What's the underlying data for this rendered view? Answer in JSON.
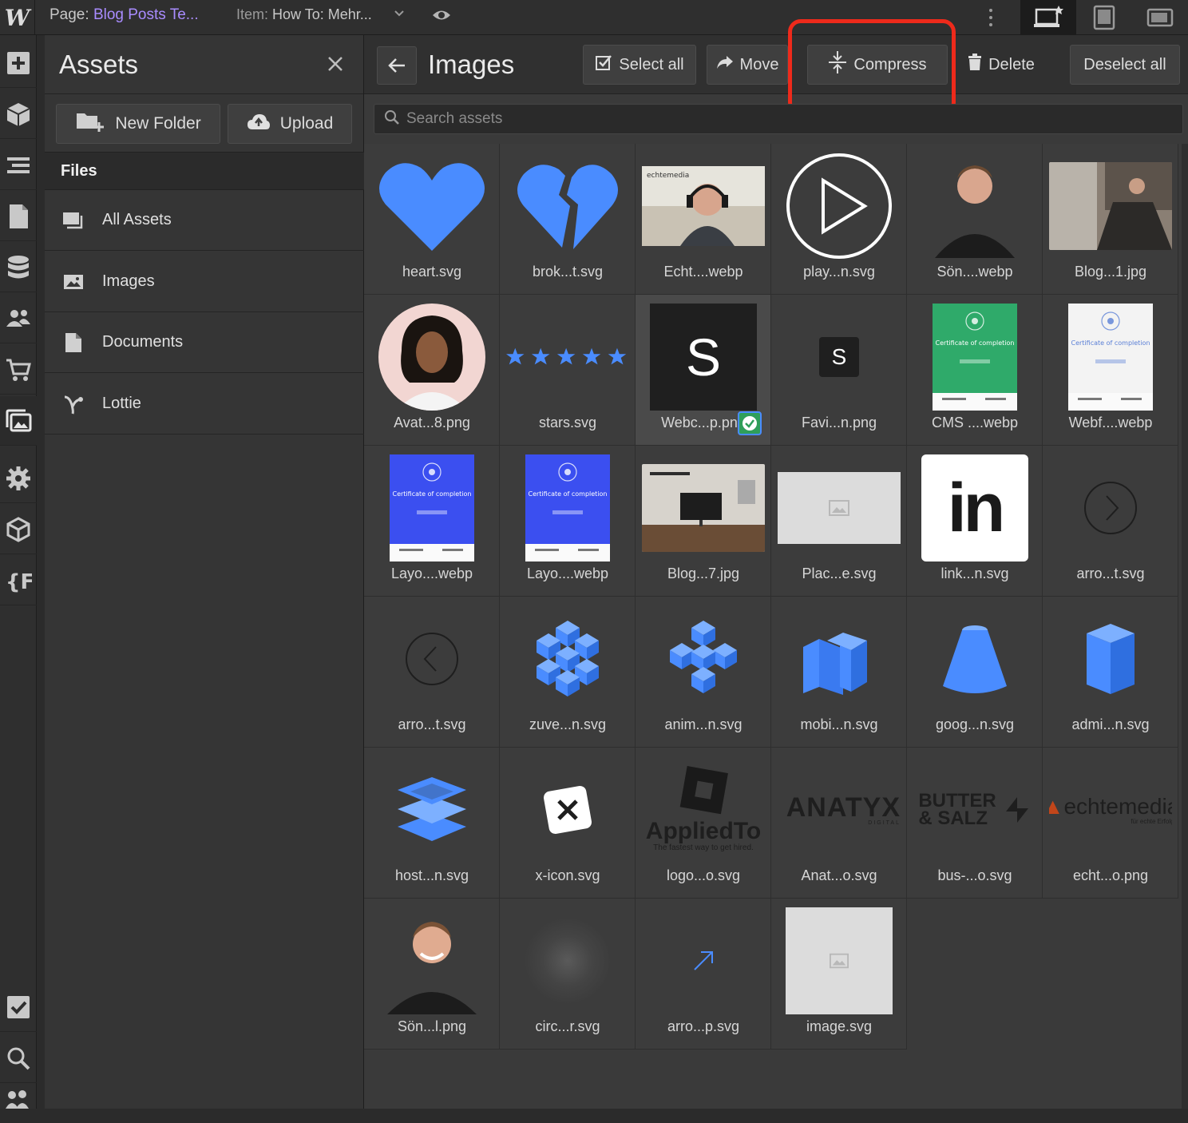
{
  "topbar": {
    "logo": "W",
    "page_prefix": "Page:",
    "page_name": "Blog Posts Te...",
    "item_prefix": "Item:",
    "item_name": "How To: Mehr..."
  },
  "assets_panel": {
    "title": "Assets",
    "new_folder_label": "New Folder",
    "upload_label": "Upload",
    "files_heading": "Files",
    "folders": [
      {
        "label": "All Assets",
        "icon": "all-assets-icon"
      },
      {
        "label": "Images",
        "icon": "image-icon"
      },
      {
        "label": "Documents",
        "icon": "document-icon"
      },
      {
        "label": "Lottie",
        "icon": "lottie-icon"
      }
    ]
  },
  "main": {
    "title": "Images",
    "toolbar": {
      "select_all": "Select all",
      "move": "Move",
      "compress": "Compress",
      "delete": "Delete",
      "deselect_all": "Deselect all"
    },
    "search_placeholder": "Search assets",
    "assets": [
      {
        "name": "heart.svg",
        "kind": "heart"
      },
      {
        "name": "brok...t.svg",
        "kind": "broken-heart"
      },
      {
        "name": "Echt....webp",
        "kind": "photo-webcam"
      },
      {
        "name": "play...n.svg",
        "kind": "play"
      },
      {
        "name": "Sön....webp",
        "kind": "photo-person"
      },
      {
        "name": "Blog...1.jpg",
        "kind": "photo-room"
      },
      {
        "name": "Avat...8.png",
        "kind": "avatar"
      },
      {
        "name": "stars.svg",
        "kind": "stars"
      },
      {
        "name": "Webc...p.png",
        "kind": "s-large",
        "selected": true
      },
      {
        "name": "Favi...n.png",
        "kind": "s-small"
      },
      {
        "name": "CMS ....webp",
        "kind": "cert-green"
      },
      {
        "name": "Webf....webp",
        "kind": "cert-white"
      },
      {
        "name": "Layo....webp",
        "kind": "cert-blue"
      },
      {
        "name": "Layo....webp",
        "kind": "cert-blue"
      },
      {
        "name": "Blog...7.jpg",
        "kind": "photo-desk"
      },
      {
        "name": "Plac...e.svg",
        "kind": "placeholder-wide"
      },
      {
        "name": "link...n.svg",
        "kind": "linkedin"
      },
      {
        "name": "arro...t.svg",
        "kind": "arrow-right-circle"
      },
      {
        "name": "arro...t.svg",
        "kind": "arrow-left-circle"
      },
      {
        "name": "zuve...n.svg",
        "kind": "cubes"
      },
      {
        "name": "anim...n.svg",
        "kind": "cross-cube"
      },
      {
        "name": "mobi...n.svg",
        "kind": "blocks"
      },
      {
        "name": "goog...n.svg",
        "kind": "cone"
      },
      {
        "name": "admi...n.svg",
        "kind": "prism"
      },
      {
        "name": "host...n.svg",
        "kind": "layers"
      },
      {
        "name": "x-icon.svg",
        "kind": "x-icon"
      },
      {
        "name": "logo...o.svg",
        "kind": "appliedto"
      },
      {
        "name": "Anat...o.svg",
        "kind": "anatyx"
      },
      {
        "name": "bus-...o.svg",
        "kind": "butter-salz"
      },
      {
        "name": "echt...o.png",
        "kind": "echtemedia"
      },
      {
        "name": "Sön...l.png",
        "kind": "photo-person-2"
      },
      {
        "name": "circ...r.svg",
        "kind": "circle-blur"
      },
      {
        "name": "arro...p.svg",
        "kind": "arrow-up-right"
      },
      {
        "name": "image.svg",
        "kind": "placeholder-square"
      }
    ],
    "logo_texts": {
      "appliedto": "AppliedTo",
      "appliedto_tag": "The fastest way to get hired.",
      "anatyx": "ANATYX",
      "anatyx_sub": "DIGITAL",
      "butter_1": "BUTTER",
      "butter_2": "& SALZ",
      "echtemedia": "echtemedia",
      "echtemedia_sub": "für echte Erfolge.",
      "s_letter": "S",
      "in_letters": "in",
      "cert_title": "Certificate of completion"
    }
  },
  "colors": {
    "accent_blue": "#4a8cff",
    "highlight_red": "#ee2a1b",
    "page_name_purple": "#a98cff",
    "check_green": "#2f9e5a"
  }
}
